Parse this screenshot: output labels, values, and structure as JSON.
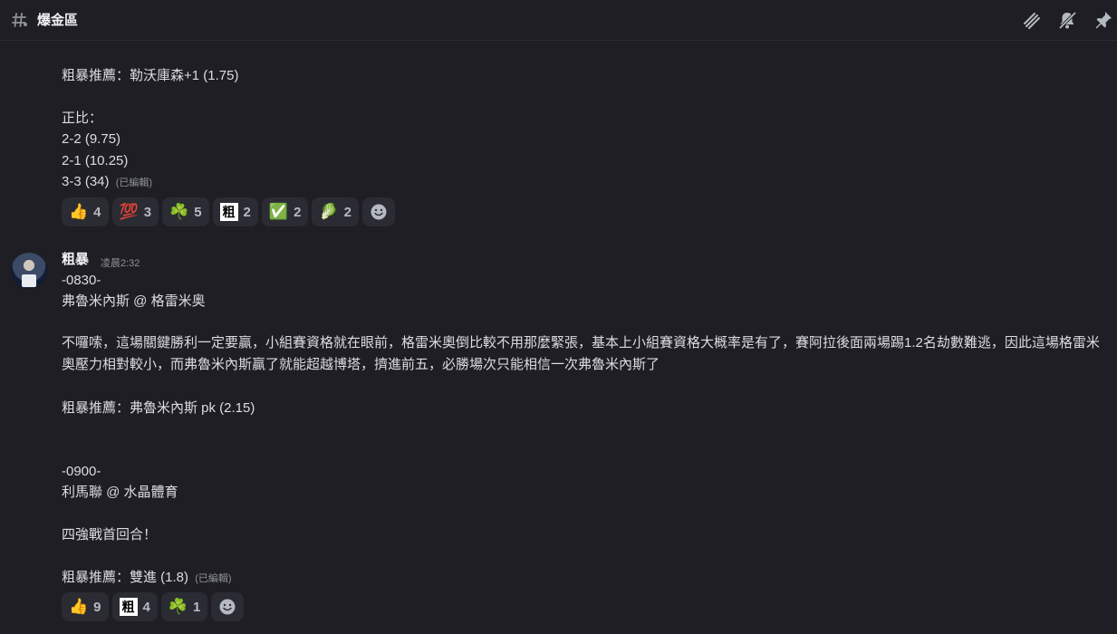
{
  "header": {
    "channel_name": "爆金區",
    "icons": [
      "threads-icon",
      "mute-bell-icon",
      "pin-icon"
    ]
  },
  "message1": {
    "lines": {
      "l1": "粗暴推薦：勒沃庫森+1 (1.75)",
      "l2": "正比：",
      "l3": "2-2  (9.75)",
      "l4": "2-1  (10.25)",
      "l5": "3-3  (34)"
    },
    "edited": "(已編輯)",
    "reactions": [
      {
        "emoji": "👍",
        "count": "4"
      },
      {
        "emoji": "💯",
        "count": "3"
      },
      {
        "emoji": "☘️",
        "count": "5"
      },
      {
        "emoji": "粗",
        "count": "2"
      },
      {
        "emoji": "✅",
        "count": "2"
      },
      {
        "emoji": "🥬",
        "count": "2"
      }
    ]
  },
  "message2": {
    "author": "粗暴",
    "timestamp": "凌晨2:32",
    "lines": {
      "l1": "-0830-",
      "l2": "弗魯米內斯 @ 格雷米奥",
      "para": "不囉嗦，這場關鍵勝利一定要贏，小組賽資格就在眼前，格雷米奧倒比較不用那麼緊張，基本上小組賽資格大概率是有了，賽阿拉後面兩場踢1.2名劫數難逃，因此這場格雷米奧壓力相對較小，而弗魯米內斯贏了就能超越博塔，擠進前五，必勝場次只能相信一次弗魯米內斯了",
      "l3": "粗暴推薦：弗魯米內斯 pk (2.15)",
      "l4": "-0900-",
      "l5": "利馬聯 @ 水晶體育",
      "l6": "四強戰首回合！",
      "l7": "粗暴推薦：雙進 (1.8)"
    },
    "edited": "(已編輯)",
    "reactions": [
      {
        "emoji": "👍",
        "count": "9"
      },
      {
        "emoji": "粗",
        "count": "4"
      },
      {
        "emoji": "☘️",
        "count": "1"
      }
    ]
  }
}
